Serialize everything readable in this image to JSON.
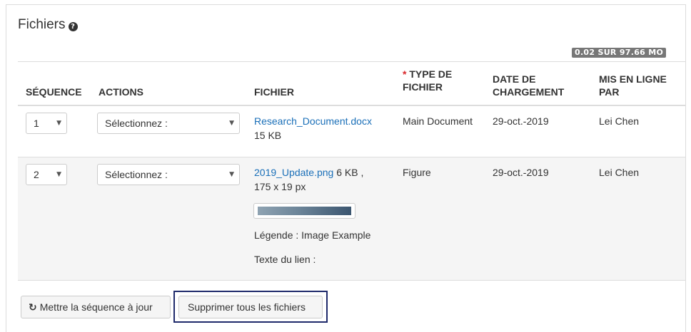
{
  "panel": {
    "title": "Fichiers",
    "help_icon": "question-circle-icon",
    "quota": "0.02 SUR 97.66 MO"
  },
  "table": {
    "headers": {
      "sequence": "SÉQUENCE",
      "actions": "ACTIONS",
      "file": "FICHIER",
      "required_mark": "*",
      "file_type_l1": "TYPE DE",
      "file_type_l2": "FICHIER",
      "upload_date_l1": "DATE DE",
      "upload_date_l2": "CHARGEMENT",
      "uploaded_by_l1": "MIS EN LIGNE",
      "uploaded_by_l2": "PAR"
    },
    "rows": [
      {
        "sequence": "1",
        "action": "Sélectionnez :",
        "file_name": "Research_Document.docx",
        "file_size": "15 KB",
        "file_type": "Main Document",
        "date": "29-oct.-2019",
        "uploaded_by": "Lei Chen"
      },
      {
        "sequence": "2",
        "action": "Sélectionnez :",
        "file_name": "2019_Update.png",
        "file_size": "6 KB ,",
        "dimensions": "175 x 19 px",
        "caption": "Légende : Image Example",
        "link_text": "Texte du lien :",
        "file_type": "Figure",
        "date": "29-oct.-2019",
        "uploaded_by": "Lei Chen"
      }
    ]
  },
  "buttons": {
    "update_sequence": "Mettre la séquence à jour",
    "update_icon": "refresh-icon",
    "delete_all": "Supprimer tous les fichiers"
  },
  "dropdown_caret": "▼",
  "refresh_glyph": "↻",
  "help_glyph": "?"
}
